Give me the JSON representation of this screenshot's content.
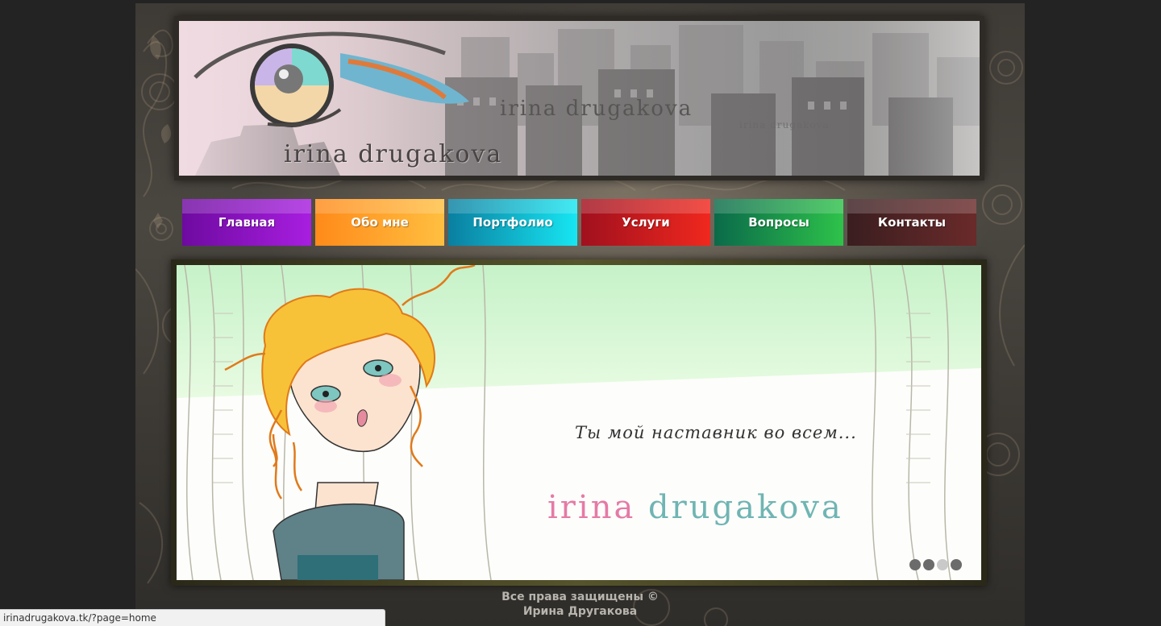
{
  "header": {
    "logo_main": "irina drugakova",
    "logo_mid": "irina drugakova",
    "logo_small": "irina drugakova"
  },
  "nav": {
    "items": [
      {
        "label": "Главная",
        "color_from": "#6e0aa0",
        "color_to": "#a81ee0"
      },
      {
        "label": "Обо мне",
        "color_from": "#ff8a1a",
        "color_to": "#ffbf40"
      },
      {
        "label": "Портфолио",
        "color_from": "#0a7fa0",
        "color_to": "#17e6f2"
      },
      {
        "label": "Услуги",
        "color_from": "#a0101e",
        "color_to": "#f0281e"
      },
      {
        "label": "Вопросы",
        "color_from": "#0a6a4a",
        "color_to": "#2ec24a"
      },
      {
        "label": "Контакты",
        "color_from": "#3a1e20",
        "color_to": "#6a2a2a"
      }
    ]
  },
  "slider": {
    "quote": "Ты мой наставник во всем...",
    "brand_part1": "irina",
    "brand_part2": "drugakova",
    "dot_count": 4,
    "active_dot": 3
  },
  "footer": {
    "line1": "Все права защищены ©",
    "line2": "Ирина Другакова"
  },
  "statusbar": {
    "url": "irinadrugakova.tk/?page=home"
  }
}
